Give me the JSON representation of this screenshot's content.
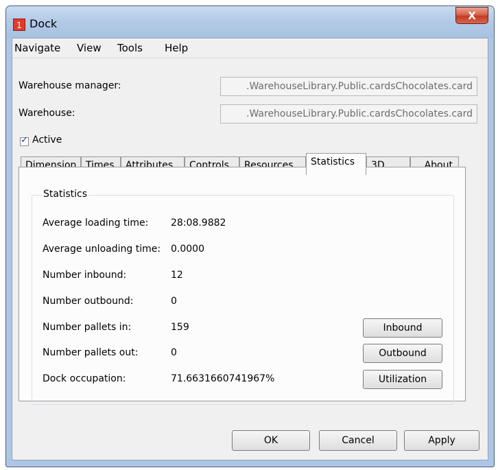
{
  "window": {
    "title": "Dock",
    "icon_text": "1",
    "close_glyph": "X"
  },
  "menu": [
    "Navigate",
    "View",
    "Tools",
    "Help"
  ],
  "fields": {
    "warehouse_manager_label": "Warehouse manager:",
    "warehouse_manager_value": ".WarehouseLibrary.Public.cardsChocolates.card",
    "warehouse_label": "Warehouse:",
    "warehouse_value": ".WarehouseLibrary.Public.cardsChocolates.card"
  },
  "active": {
    "label": "Active",
    "checked": true
  },
  "tabs": [
    "Dimension",
    "Times",
    "Attributes",
    "Controls",
    "Resources",
    "Statistics",
    "3D",
    "About"
  ],
  "active_tab": "Statistics",
  "statistics": {
    "group_title": "Statistics",
    "rows": [
      {
        "label": "Average loading time:",
        "value": "28:08.9882"
      },
      {
        "label": "Average unloading time:",
        "value": "0.0000"
      },
      {
        "label": "Number inbound:",
        "value": "12"
      },
      {
        "label": "Number outbound:",
        "value": "0"
      },
      {
        "label": "Number pallets in:",
        "value": "159"
      },
      {
        "label": "Number pallets out:",
        "value": "0"
      },
      {
        "label": "Dock occupation:",
        "value": "71.6631660741967%"
      }
    ],
    "buttons": {
      "inbound": "Inbound",
      "outbound": "Outbound",
      "utilization": "Utilization"
    }
  },
  "footer": {
    "ok": "OK",
    "cancel": "Cancel",
    "apply": "Apply"
  }
}
